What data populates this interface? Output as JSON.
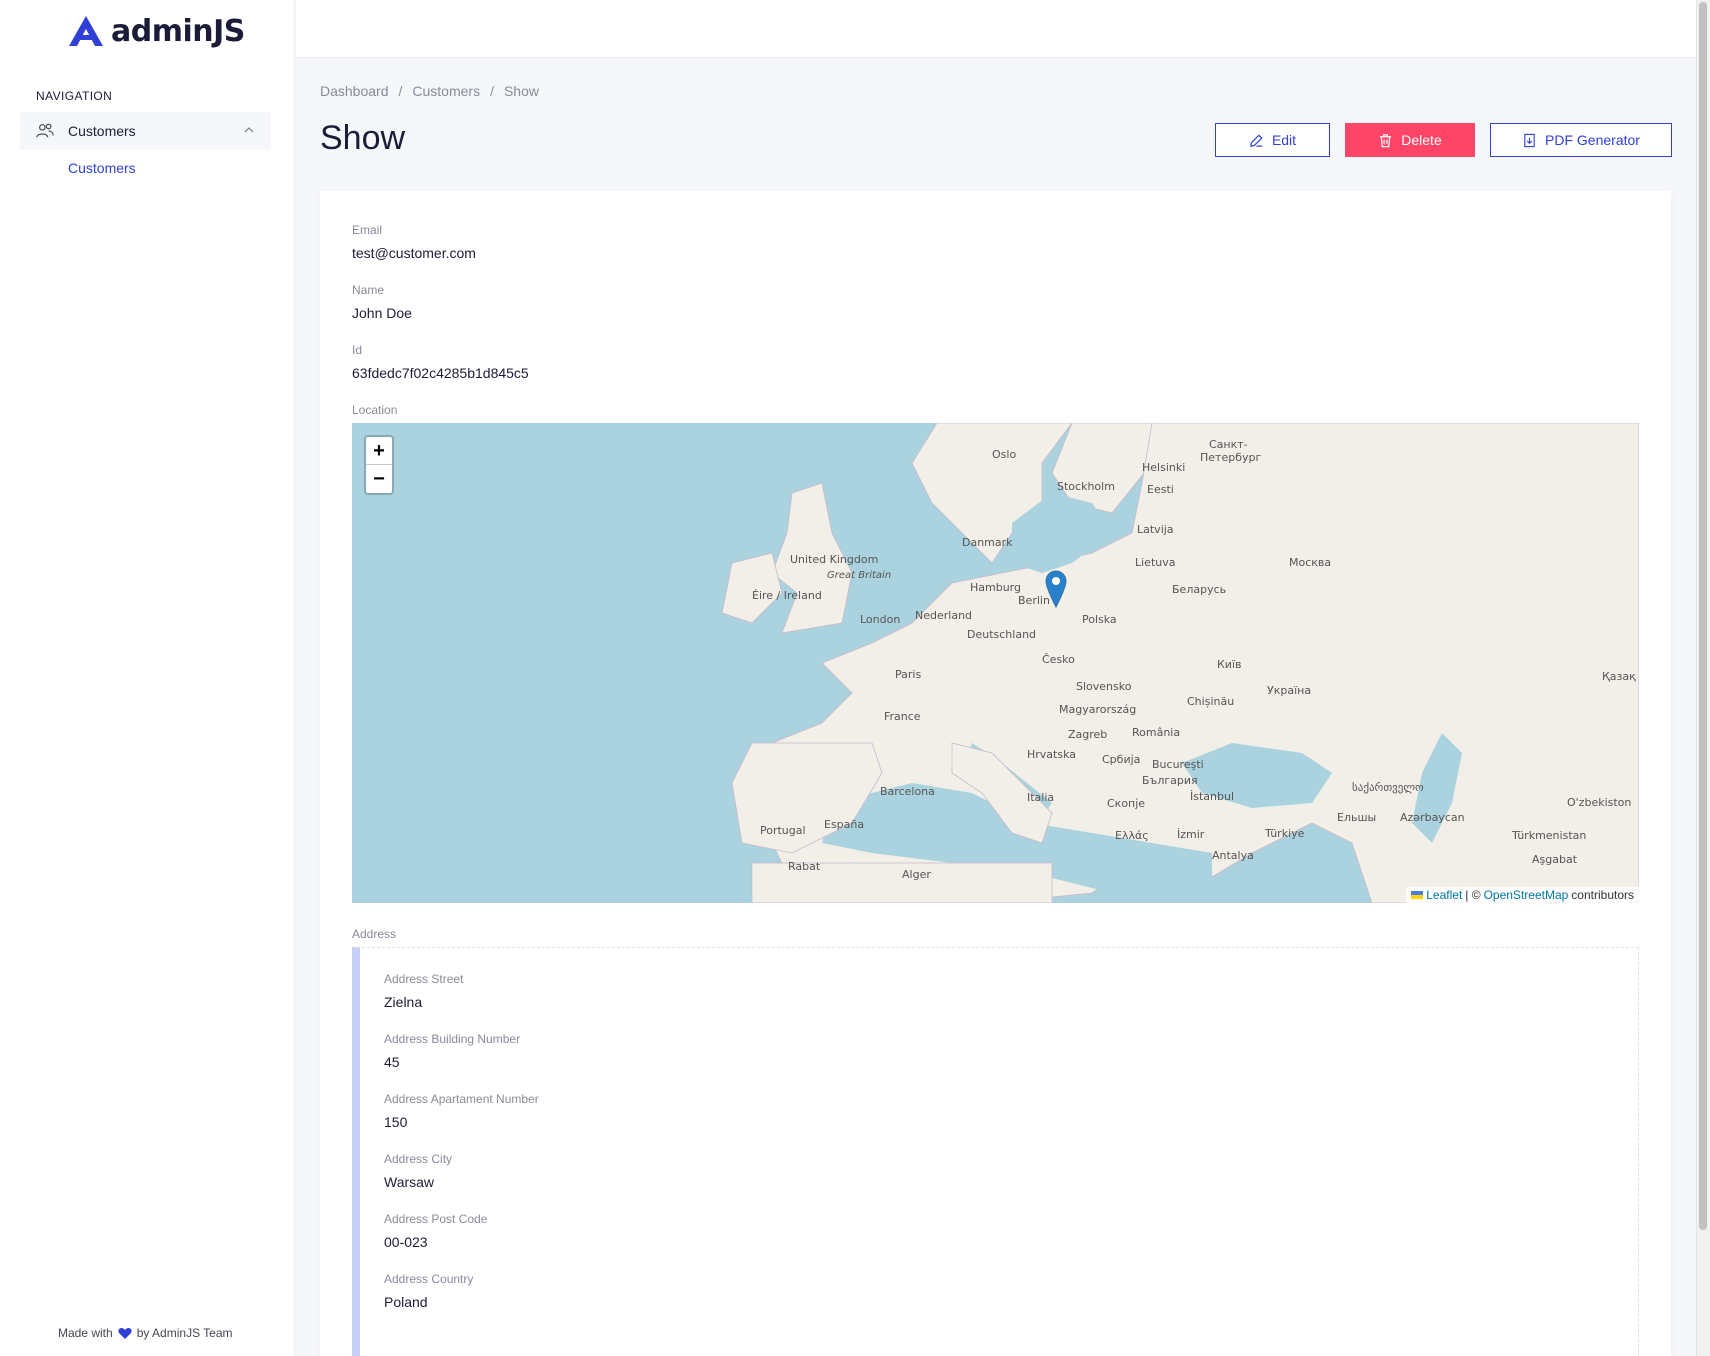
{
  "brand": {
    "name": "adminJS"
  },
  "navigation": {
    "heading": "NAVIGATION",
    "group_label": "Customers",
    "sub_item": "Customers"
  },
  "footer": {
    "prefix": "Made with",
    "suffix": "by AdminJS Team"
  },
  "breadcrumb": [
    "Dashboard",
    "Customers",
    "Show"
  ],
  "page": {
    "title": "Show"
  },
  "actions": {
    "edit": "Edit",
    "delete": "Delete",
    "pdf": "PDF Generator"
  },
  "record": {
    "email": {
      "label": "Email",
      "value": "test@customer.com"
    },
    "name": {
      "label": "Name",
      "value": "John Doe"
    },
    "id": {
      "label": "Id",
      "value": "63fdedc7f02c4285b1d845c5"
    },
    "location": {
      "label": "Location"
    },
    "address": {
      "label": "Address",
      "street": {
        "label": "Address Street",
        "value": "Zielna"
      },
      "building": {
        "label": "Address Building Number",
        "value": "45"
      },
      "apartment": {
        "label": "Address Apartament Number",
        "value": "150"
      },
      "city": {
        "label": "Address City",
        "value": "Warsaw"
      },
      "postcode": {
        "label": "Address Post Code",
        "value": "00-023"
      },
      "country": {
        "label": "Address Country",
        "value": "Poland"
      }
    }
  },
  "map": {
    "zoom_in": "+",
    "zoom_out": "−",
    "attribution_leaflet": "Leaflet",
    "attribution_sep": "| ©",
    "attribution_osm": "OpenStreetMap",
    "attribution_suffix": "contributors",
    "labels": [
      "Oslo",
      "Stockholm",
      "Helsinki",
      "Санкт-",
      "Петербург",
      "Eesti",
      "Latvija",
      "Lietuva",
      "Москва",
      "Danmark",
      "United Kingdom",
      "Great Britain",
      "Éire / Ireland",
      "Hamburg",
      "Berlin",
      "Беларусь",
      "London",
      "Nederland",
      "Polska",
      "Deutschland",
      "Česko",
      "Київ",
      "Paris",
      "Slovensko",
      "Україна",
      "France",
      "Magyarország",
      "Chișinău",
      "Zagreb",
      "România",
      "Hrvatska",
      "Србија",
      "Bucureşti",
      "България",
      "Barcelona",
      "Italia",
      "Скопје",
      "İstanbul",
      "საქართველო",
      "Ельшы",
      "Azərbaycan",
      "Portugal",
      "España",
      "Ελλάς",
      "İzmir",
      "Türkiye",
      "Antalya",
      "Rabat",
      "Alger",
      "Türkmenistan",
      "Aşgabat",
      "O'zbekiston",
      "Қазақ"
    ],
    "colors": {
      "water": "#aad3df",
      "land": "#f2efe9",
      "marker": "#2a81cb"
    }
  }
}
